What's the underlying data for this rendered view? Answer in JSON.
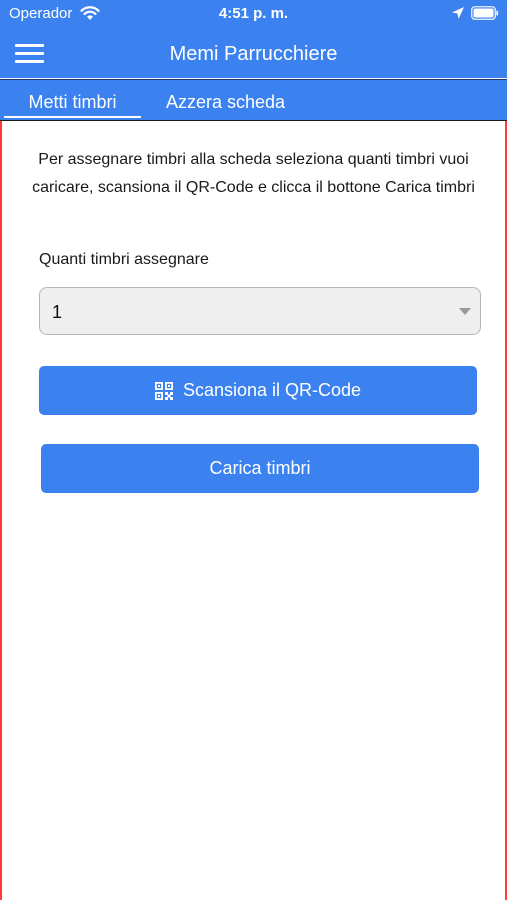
{
  "status_bar": {
    "carrier": "Operador",
    "time": "4:51 p. m.",
    "icons": [
      "wifi-icon",
      "location-arrow-icon",
      "battery-icon"
    ]
  },
  "header": {
    "title": "Memi Parrucchiere",
    "menu_icon": "hamburger-menu-icon"
  },
  "tabs": [
    {
      "label": "Metti timbri",
      "active": true
    },
    {
      "label": "Azzera scheda",
      "active": false
    }
  ],
  "main": {
    "instructions": "Per assegnare timbri alla scheda seleziona quanti timbri vuoi caricare, scansiona il QR-Code e clicca il bottone Carica timbri",
    "quantity_label": "Quanti timbri assegnare",
    "quantity_value": "1",
    "scan_button_label": "Scansiona il QR-Code",
    "scan_button_icon": "qr-code-icon",
    "load_button_label": "Carica timbri"
  },
  "colors": {
    "primary": "#3b82f0",
    "content_border": "#ff3b3b",
    "select_bg": "#efefef"
  }
}
